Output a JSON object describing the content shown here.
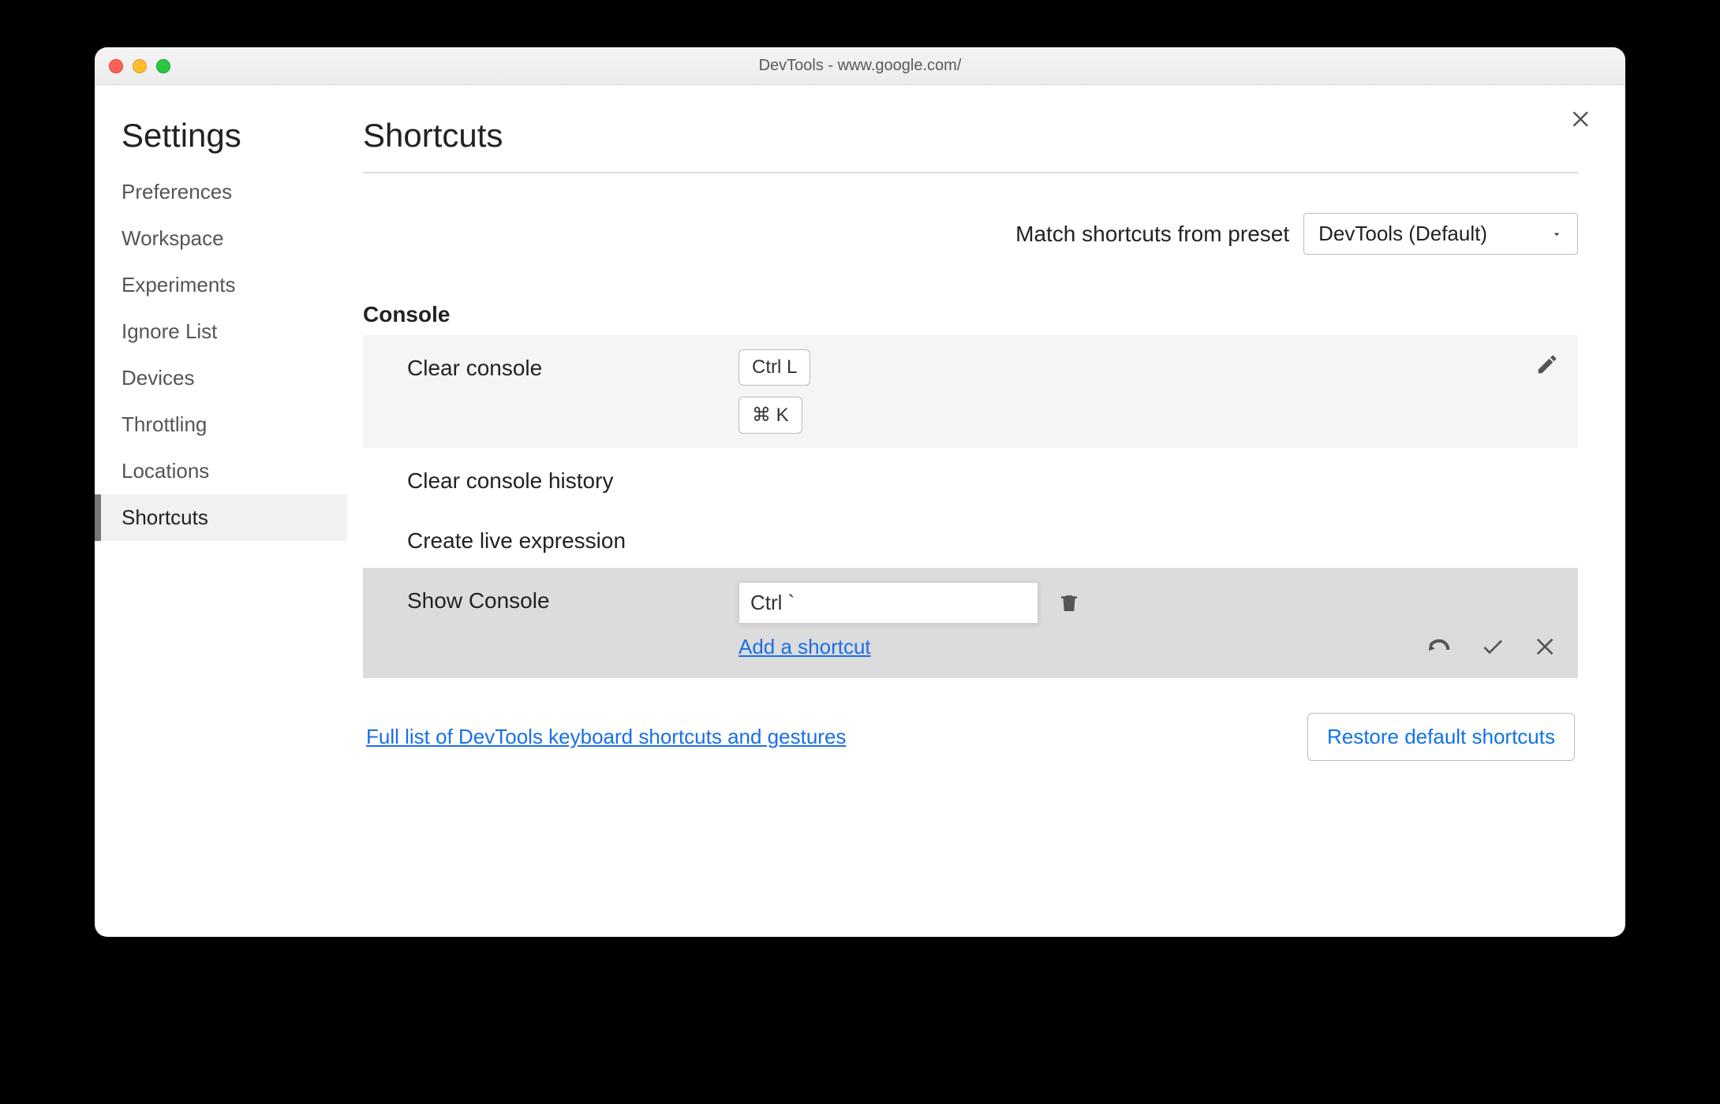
{
  "window_title": "DevTools - www.google.com/",
  "sidebar": {
    "heading": "Settings",
    "items": [
      "Preferences",
      "Workspace",
      "Experiments",
      "Ignore List",
      "Devices",
      "Throttling",
      "Locations",
      "Shortcuts"
    ],
    "active_index": 7
  },
  "main": {
    "heading": "Shortcuts",
    "preset_label": "Match shortcuts from preset",
    "preset_value": "DevTools (Default)",
    "section": "Console",
    "rows": {
      "clear_console": {
        "label": "Clear console",
        "keys": [
          "Ctrl L",
          "⌘ K"
        ]
      },
      "clear_history": {
        "label": "Clear console history"
      },
      "create_live": {
        "label": "Create live expression"
      },
      "show_console": {
        "label": "Show Console",
        "input_value": "Ctrl `",
        "add_link": "Add a shortcut"
      }
    },
    "footer_link": "Full list of DevTools keyboard shortcuts and gestures",
    "restore_button": "Restore default shortcuts"
  }
}
